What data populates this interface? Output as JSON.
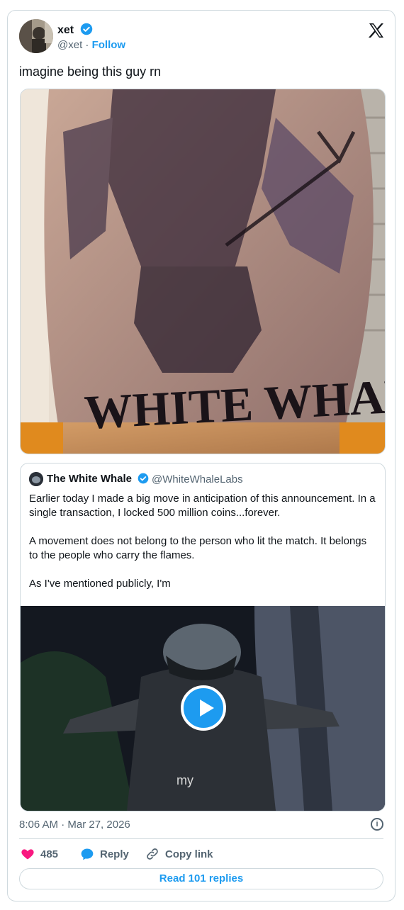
{
  "author": {
    "name": "xet",
    "handle": "@xet",
    "separator": "·",
    "follow_label": "Follow",
    "verified": true
  },
  "tweet": {
    "text": "imagine being this guy rn",
    "media_caption": "WHITE WHALE"
  },
  "quoted_tweet": {
    "name": "The White Whale",
    "handle": "@WhiteWhaleLabs",
    "text": "Earlier today I made a big move in anticipation of this announcement. In a single transaction, I locked 500 million coins...forever.\n\nA movement does not belong to the person who lit the match. It belongs to the people who carry the flames.\n\nAs I've mentioned publicly, I'm",
    "video_subtitle": "my"
  },
  "meta": {
    "timestamp": "8:06 AM · Mar 27, 2026"
  },
  "actions": {
    "likes": "485",
    "reply_label": "Reply",
    "copy_label": "Copy link",
    "read_replies_label": "Read 101 replies"
  },
  "colors": {
    "accent": "#1d9bf0",
    "like": "#f91880",
    "text_secondary": "#536471",
    "border": "#cfd9de"
  }
}
